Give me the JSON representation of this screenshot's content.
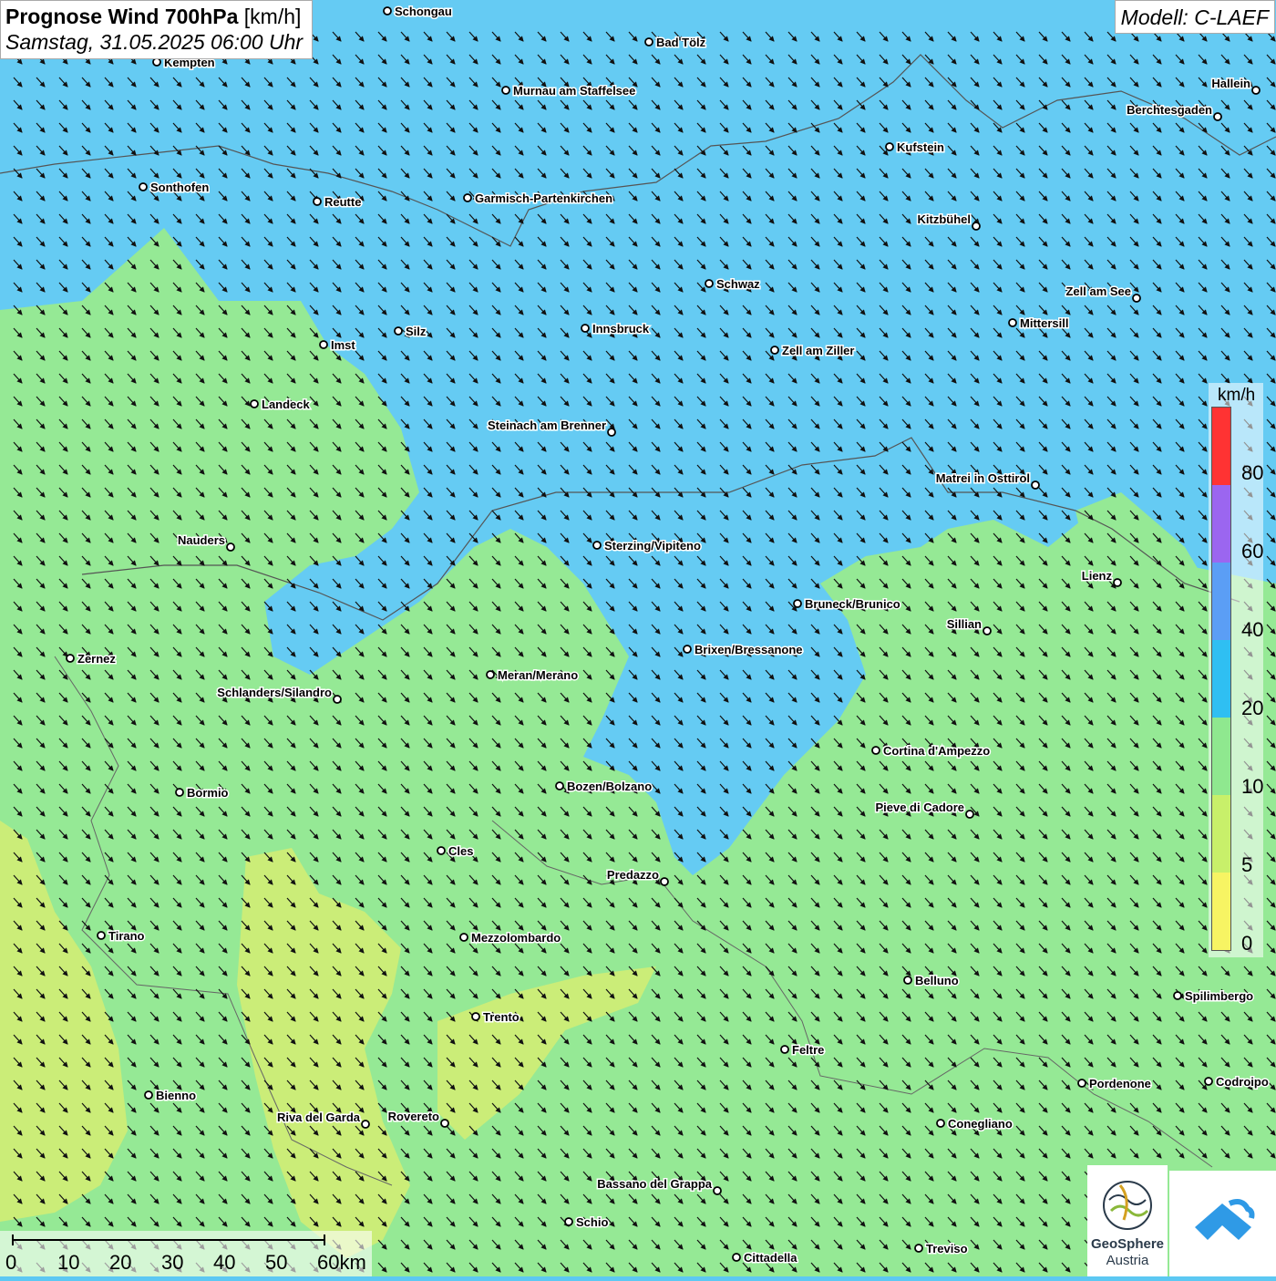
{
  "header": {
    "title_bold": "Prognose Wind 700hPa",
    "title_unit": "[km/h]",
    "date": "Samstag, 31.05.2025 06:00 Uhr"
  },
  "model": "Modell: C-LAEF",
  "legend": {
    "unit": "km/h",
    "ticks": [
      "80",
      "60",
      "40",
      "20",
      "10",
      "5",
      "0"
    ],
    "colors": [
      "#ff3333",
      "#9b66f0",
      "#5b9ef5",
      "#2fbff2",
      "#8fe88f",
      "#c8f06a",
      "#f7f463"
    ]
  },
  "scale": {
    "labels": [
      "0",
      "10",
      "20",
      "30",
      "40",
      "50",
      "60km"
    ]
  },
  "logos": {
    "geosphere_line1": "GeoSphere",
    "geosphere_line2": "Austria"
  },
  "colors": {
    "strong_wind_area": "#5cc8f3",
    "moderate_wind_area": "#8fe88f",
    "weak_wind_area": "#c8ec70"
  },
  "cities": [
    {
      "name": "Schongau"
    },
    {
      "name": "Bad Tölz"
    },
    {
      "name": "Kempten"
    },
    {
      "name": "Murnau am Staffelsee"
    },
    {
      "name": "Hallein"
    },
    {
      "name": "Berchtesgaden"
    },
    {
      "name": "Kufstein"
    },
    {
      "name": "Sonthofen"
    },
    {
      "name": "Reutte"
    },
    {
      "name": "Garmisch-Partenkirchen"
    },
    {
      "name": "Kitzbühel"
    },
    {
      "name": "Schwaz"
    },
    {
      "name": "Zell am See"
    },
    {
      "name": "Innsbruck"
    },
    {
      "name": "Mittersill"
    },
    {
      "name": "Silz"
    },
    {
      "name": "Imst"
    },
    {
      "name": "Zell am Ziller"
    },
    {
      "name": "Landeck"
    },
    {
      "name": "Steinach am Brenner"
    },
    {
      "name": "Matrei in Osttirol"
    },
    {
      "name": "Nauders"
    },
    {
      "name": "Sterzing/Vipiteno"
    },
    {
      "name": "Lienz"
    },
    {
      "name": "Bruneck/Brunico"
    },
    {
      "name": "Sillian"
    },
    {
      "name": "Brixen/Bressanone"
    },
    {
      "name": "Zernez"
    },
    {
      "name": "Meran/Merano"
    },
    {
      "name": "Schlanders/Silandro"
    },
    {
      "name": "Cortina d'Ampezzo"
    },
    {
      "name": "Bozen/Bolzano"
    },
    {
      "name": "Bormio"
    },
    {
      "name": "Pieve di Cadore"
    },
    {
      "name": "Cles"
    },
    {
      "name": "Predazzo"
    },
    {
      "name": "Tirano"
    },
    {
      "name": "Mezzolombardo"
    },
    {
      "name": "Belluno"
    },
    {
      "name": "Spilimbergo"
    },
    {
      "name": "Trento"
    },
    {
      "name": "Feltre"
    },
    {
      "name": "Pordenone"
    },
    {
      "name": "Codroipo"
    },
    {
      "name": "Bienno"
    },
    {
      "name": "Riva del Garda"
    },
    {
      "name": "Rovereto"
    },
    {
      "name": "Conegliano"
    },
    {
      "name": "Bassano del Grappa"
    },
    {
      "name": "Schio"
    },
    {
      "name": "Treviso"
    },
    {
      "name": "Cittadella"
    }
  ]
}
